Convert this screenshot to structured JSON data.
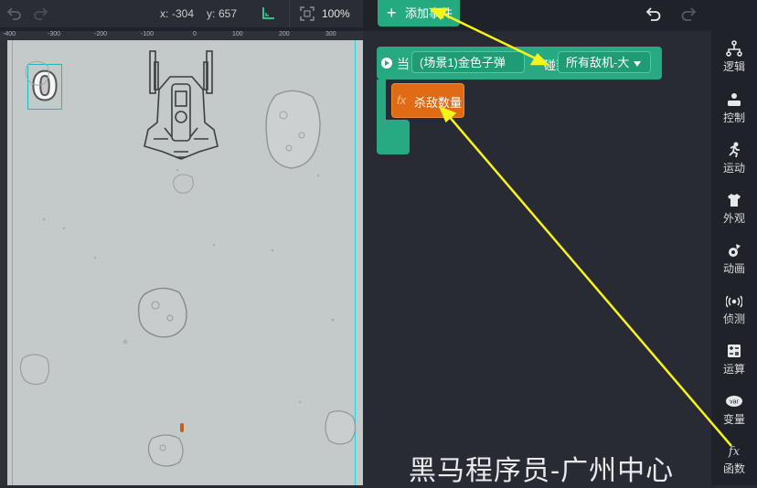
{
  "stage_toolbar": {
    "x_label": "x:",
    "x_value": "-304",
    "y_label": "y:",
    "y_value": "657",
    "zoom": "100%"
  },
  "ruler": {
    "ticks": [
      "-400",
      "-300",
      "-200",
      "-100",
      "0",
      "100",
      "200",
      "300"
    ]
  },
  "stage": {
    "score": "0"
  },
  "code_area": {
    "add_event_label": "添加事件",
    "event": {
      "when_label": "当",
      "sprite_dropdown": "(场景1)金色子弹",
      "touch_label": "碰到",
      "target_dropdown": "所有敌机-大"
    },
    "function_block": {
      "fx": "fx",
      "name": "杀敌数量"
    }
  },
  "sidebar": {
    "items": [
      {
        "label": "逻辑",
        "icon": "logic-icon"
      },
      {
        "label": "控制",
        "icon": "control-icon"
      },
      {
        "label": "运动",
        "icon": "running-figure-icon"
      },
      {
        "label": "外观",
        "icon": "shirt-icon"
      },
      {
        "label": "动画",
        "icon": "animation-icon"
      },
      {
        "label": "侦测",
        "icon": "sensor-icon"
      },
      {
        "label": "运算",
        "icon": "calculator-icon"
      },
      {
        "label": "变量",
        "icon": "var-icon"
      },
      {
        "label": "函数",
        "icon": "fx-icon"
      }
    ]
  },
  "watermark": "黑马程序员-广州中心",
  "colors": {
    "event_green": "#27a982",
    "function_orange": "#df6b14",
    "guide_cyan": "#29d3d8",
    "arrow_yellow": "#f7f41a",
    "stage_bg": "#c4c9c9"
  }
}
